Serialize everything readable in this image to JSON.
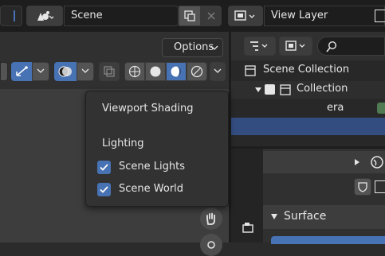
{
  "topbar": {
    "scene_label": "Scene",
    "view_layer_label": "View Layer"
  },
  "viewport_header": {
    "options_label": "Options"
  },
  "popover": {
    "title": "Viewport Shading",
    "section_lighting": "Lighting",
    "scene_lights_label": "Scene Lights",
    "scene_lights_checked": true,
    "scene_world_label": "Scene World",
    "scene_world_checked": true
  },
  "outliner": {
    "scene_collection_label": "Scene Collection",
    "collection_label": "Collection",
    "camera_partial_label": "era"
  },
  "properties": {
    "surface_label": "Surface"
  },
  "colors": {
    "accent": "#4772b3",
    "checkbox": "#4772b3",
    "popover_bg": "#323232",
    "panel_bg": "#303030",
    "header_bg": "#3d3d3d"
  }
}
